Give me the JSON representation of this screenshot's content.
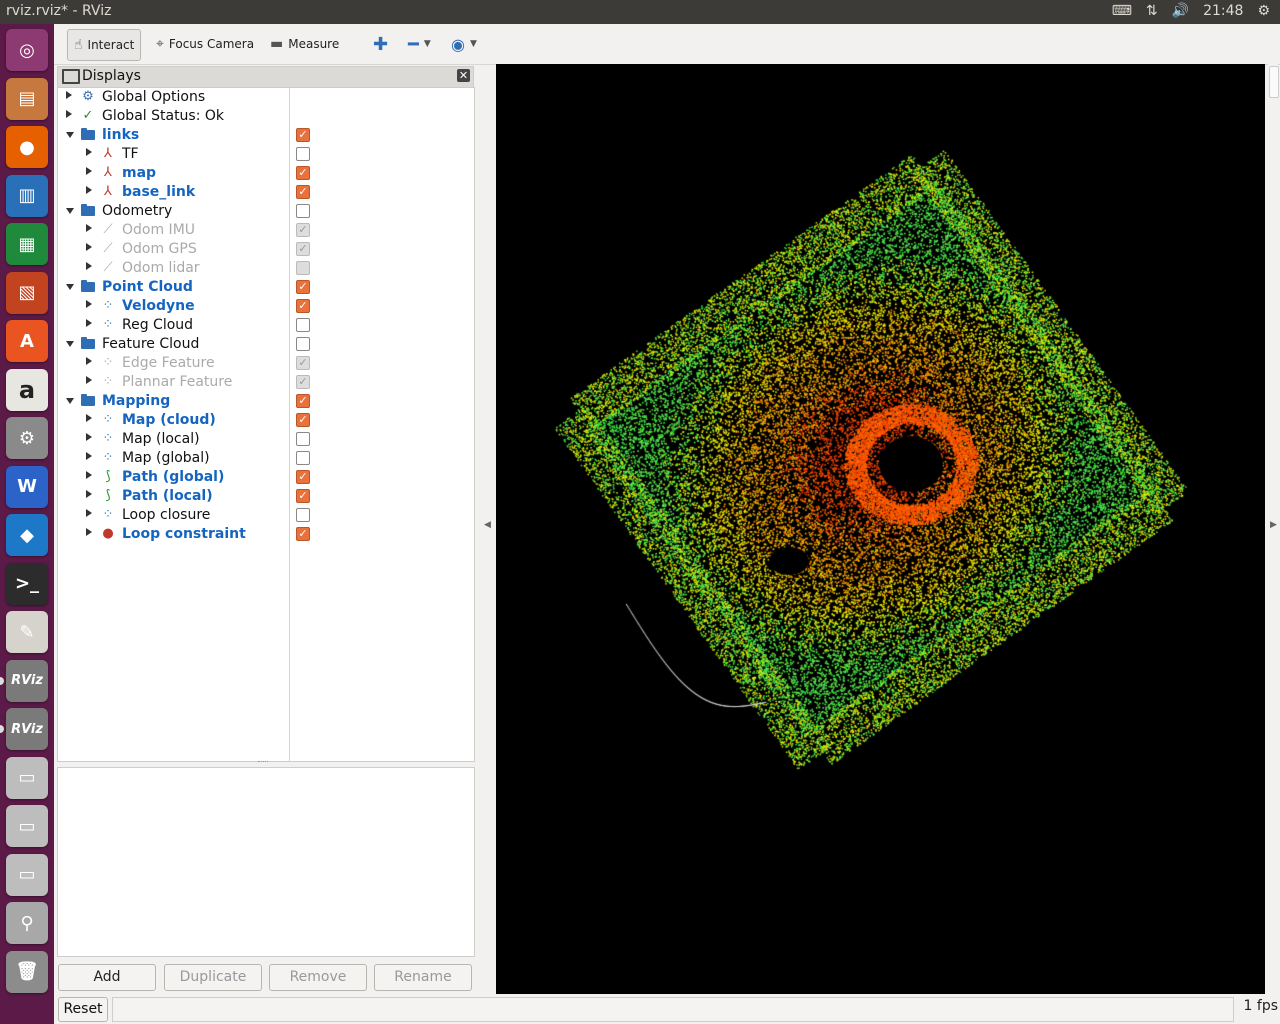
{
  "window": {
    "title": "rviz.rviz* - RViz"
  },
  "tray": {
    "keyboard_icon": "keyboard-icon",
    "network_icon": "network-icon",
    "volume_icon": "volume-icon",
    "clock": "21:48"
  },
  "launcher": [
    {
      "name": "ubuntu-dash-icon",
      "glyph": "◎",
      "bg": "#8d3a73"
    },
    {
      "name": "files-icon",
      "glyph": "▤",
      "bg": "#c7783e"
    },
    {
      "name": "firefox-icon",
      "glyph": "●",
      "bg": "#e66000"
    },
    {
      "name": "writer-icon",
      "glyph": "▥",
      "bg": "#2a70b8"
    },
    {
      "name": "calc-icon",
      "glyph": "▦",
      "bg": "#1f8a3b"
    },
    {
      "name": "impress-icon",
      "glyph": "▧",
      "bg": "#c2431f"
    },
    {
      "name": "software-center-icon",
      "glyph": "A",
      "bg": "#e95420"
    },
    {
      "name": "amazon-icon",
      "glyph": "a",
      "bg": "#e8e6e1"
    },
    {
      "name": "system-settings-icon",
      "glyph": "⚙",
      "bg": "#8a8a8a"
    },
    {
      "name": "wps-icon",
      "glyph": "W",
      "bg": "#2b63c9"
    },
    {
      "name": "vscode-icon",
      "glyph": "◆",
      "bg": "#1e78c8"
    },
    {
      "name": "terminal-icon",
      "glyph": ">_",
      "bg": "#2c2c2c"
    },
    {
      "name": "text-editor-icon",
      "glyph": "✎",
      "bg": "#d6d3cc"
    },
    {
      "name": "rviz-icon",
      "glyph": "RViz",
      "bg": "#7a7a7a"
    },
    {
      "name": "rviz-icon",
      "glyph": "RViz",
      "bg": "#7a7a7a"
    },
    {
      "name": "drive-icon",
      "glyph": "▭",
      "bg": "#bdbdbd"
    },
    {
      "name": "drive-icon",
      "glyph": "▭",
      "bg": "#bdbdbd"
    },
    {
      "name": "drive-icon",
      "glyph": "▭",
      "bg": "#bdbdbd"
    },
    {
      "name": "usb-icon",
      "glyph": "⚲",
      "bg": "#a8a8a8"
    },
    {
      "name": "trash-icon",
      "glyph": "🗑",
      "bg": "#8c8c8c"
    }
  ],
  "toolbar": {
    "interact": "Interact",
    "focus_camera": "Focus Camera",
    "measure": "Measure"
  },
  "displays": {
    "title": "Displays",
    "rows": [
      {
        "label": "Global Options",
        "indent": 0,
        "arrow": "closed",
        "icon": "gear-icon",
        "glyph": "⚙",
        "iconcolor": "#3a6fb0",
        "style": "normal",
        "check": null
      },
      {
        "label": "Global Status: Ok",
        "indent": 0,
        "arrow": "closed",
        "icon": "check-icon",
        "glyph": "✓",
        "iconcolor": "#2a8a2a",
        "style": "normal",
        "check": null
      },
      {
        "label": "links",
        "indent": 0,
        "arrow": "open",
        "icon": "folder-icon",
        "glyph": "",
        "iconcolor": "#2f6eb5",
        "style": "bold",
        "check": "on"
      },
      {
        "label": "TF",
        "indent": 1,
        "arrow": "closed",
        "icon": "tf-axes-icon",
        "glyph": "⅄",
        "iconcolor": "#c0392b",
        "style": "normal",
        "check": "off"
      },
      {
        "label": "map",
        "indent": 1,
        "arrow": "closed",
        "icon": "axes-icon",
        "glyph": "⅄",
        "iconcolor": "#c0392b",
        "style": "bold",
        "check": "on"
      },
      {
        "label": "base_link",
        "indent": 1,
        "arrow": "closed",
        "icon": "axes-icon",
        "glyph": "⅄",
        "iconcolor": "#c0392b",
        "style": "bold",
        "check": "on"
      },
      {
        "label": "Odometry",
        "indent": 0,
        "arrow": "open",
        "icon": "folder-icon",
        "glyph": "",
        "iconcolor": "#2f6eb5",
        "style": "normal",
        "check": "off"
      },
      {
        "label": "Odom IMU",
        "indent": 1,
        "arrow": "closed",
        "icon": "odometry-icon",
        "glyph": "⟋",
        "iconcolor": "#aaa",
        "style": "disabled",
        "check": "dis"
      },
      {
        "label": "Odom GPS",
        "indent": 1,
        "arrow": "closed",
        "icon": "odometry-icon",
        "glyph": "⟋",
        "iconcolor": "#aaa",
        "style": "disabled",
        "check": "dis"
      },
      {
        "label": "Odom lidar",
        "indent": 1,
        "arrow": "closed",
        "icon": "odometry-icon",
        "glyph": "⟋",
        "iconcolor": "#aaa",
        "style": "disabled",
        "check": "disempty"
      },
      {
        "label": "Point Cloud",
        "indent": 0,
        "arrow": "open",
        "icon": "folder-icon",
        "glyph": "",
        "iconcolor": "#2f6eb5",
        "style": "bold",
        "check": "on"
      },
      {
        "label": "Velodyne",
        "indent": 1,
        "arrow": "closed",
        "icon": "pointcloud-icon",
        "glyph": "⁘",
        "iconcolor": "#2a7ab8",
        "style": "bold",
        "check": "on"
      },
      {
        "label": "Reg Cloud",
        "indent": 1,
        "arrow": "closed",
        "icon": "pointcloud-icon",
        "glyph": "⁘",
        "iconcolor": "#2a7ab8",
        "style": "normal",
        "check": "off"
      },
      {
        "label": "Feature Cloud",
        "indent": 0,
        "arrow": "open",
        "icon": "folder-icon",
        "glyph": "",
        "iconcolor": "#2f6eb5",
        "style": "normal",
        "check": "off"
      },
      {
        "label": "Edge Feature",
        "indent": 1,
        "arrow": "closed",
        "icon": "pointcloud-icon",
        "glyph": "⁘",
        "iconcolor": "#aaa",
        "style": "disabled",
        "check": "dis"
      },
      {
        "label": "Plannar Feature",
        "indent": 1,
        "arrow": "closed",
        "icon": "pointcloud-icon",
        "glyph": "⁘",
        "iconcolor": "#aaa",
        "style": "disabled",
        "check": "dis"
      },
      {
        "label": "Mapping",
        "indent": 0,
        "arrow": "open",
        "icon": "folder-icon",
        "glyph": "",
        "iconcolor": "#2f6eb5",
        "style": "bold",
        "check": "on"
      },
      {
        "label": "Map (cloud)",
        "indent": 1,
        "arrow": "closed",
        "icon": "pointcloud-icon",
        "glyph": "⁘",
        "iconcolor": "#2a7ab8",
        "style": "bold",
        "check": "on"
      },
      {
        "label": "Map (local)",
        "indent": 1,
        "arrow": "closed",
        "icon": "pointcloud-icon",
        "glyph": "⁘",
        "iconcolor": "#2a7ab8",
        "style": "normal",
        "check": "off"
      },
      {
        "label": "Map (global)",
        "indent": 1,
        "arrow": "closed",
        "icon": "pointcloud-icon",
        "glyph": "⁘",
        "iconcolor": "#2a7ab8",
        "style": "normal",
        "check": "off"
      },
      {
        "label": "Path (global)",
        "indent": 1,
        "arrow": "closed",
        "icon": "path-icon",
        "glyph": "⟆",
        "iconcolor": "#1e9a2a",
        "style": "bold",
        "check": "on"
      },
      {
        "label": "Path (local)",
        "indent": 1,
        "arrow": "closed",
        "icon": "path-icon",
        "glyph": "⟆",
        "iconcolor": "#1e9a2a",
        "style": "bold",
        "check": "on"
      },
      {
        "label": "Loop closure",
        "indent": 1,
        "arrow": "closed",
        "icon": "pointcloud-icon",
        "glyph": "⁘",
        "iconcolor": "#2a7ab8",
        "style": "normal",
        "check": "off"
      },
      {
        "label": "Loop constraint",
        "indent": 1,
        "arrow": "closed",
        "icon": "marker-icon",
        "glyph": "●",
        "iconcolor": "#c0392b",
        "style": "bold",
        "check": "on"
      }
    ]
  },
  "buttons": {
    "add": "Add",
    "duplicate": "Duplicate",
    "remove": "Remove",
    "rename": "Rename"
  },
  "status": {
    "reset": "Reset",
    "fps": "1 fps"
  },
  "colors": {
    "checked": "#e8713c",
    "bold_text": "#1565c0",
    "launcher_bg": "#5b1a47",
    "viewport_bg": "#000000"
  }
}
